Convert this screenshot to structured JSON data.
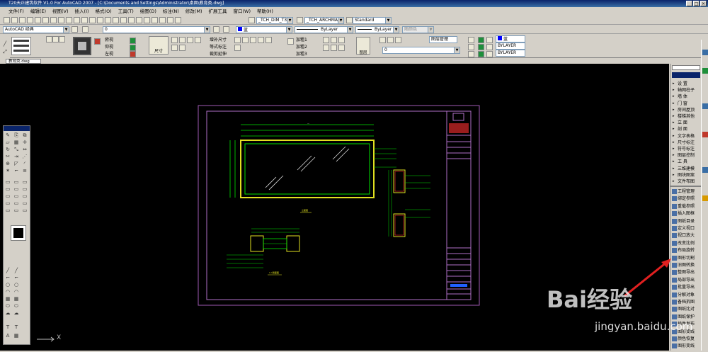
{
  "window": {
    "title": "T20天正建筑软件 V1.0 For AutoCAD 2007 - [C:\\Documents and Settings\\Administrator\\桌面\\教育类.dwg]",
    "controls": [
      "_",
      "□",
      "×"
    ]
  },
  "menu": [
    "文件(F)",
    "编辑(E)",
    "视图(V)",
    "插入(I)",
    "格式(O)",
    "工具(T)",
    "绘图(D)",
    "标注(N)",
    "修改(M)",
    "扩展工具",
    "窗口(W)",
    "帮助(H)"
  ],
  "toolbar2": {
    "dim_style": "_TCH_DIM_T3",
    "text_style": "_TCH_ARCHMAIN",
    "table_style": "Standard"
  },
  "toolbar3": {
    "workspace": "AutoCAD 经典",
    "layer": "0",
    "color": "蓝",
    "linetype": "ByLayer",
    "lineweight": "ByLayer",
    "plotstyle": "随颜色"
  },
  "ribbon": {
    "group1": [
      "俯视",
      "仰视",
      "左视"
    ],
    "group2_label": "尺寸",
    "group3": [
      "增补尺寸",
      "等式标注",
      "裁剪延伸"
    ],
    "group4": [
      "加粗1",
      "加粗2",
      "加粗3"
    ],
    "group5": [
      "图层管理",
      "图层"
    ],
    "layer_color": "蓝",
    "bylayer1": "BYLAYER",
    "bylayer2": "BYLAYER",
    "layer_zero": "0"
  },
  "doc_tab": "教育类.dwg",
  "right_panel": {
    "top_items": [
      "设 置",
      "轴网柱子",
      "墙 体",
      "门 窗",
      "房间屋顶",
      "楼梯其他",
      "立 面",
      "剖 面",
      "文字表格",
      "尺寸标注",
      "符号标注",
      "图层控制",
      "工 具",
      "三维建模",
      "图块图案",
      "文件布图"
    ],
    "bottom_items": [
      "工程管理",
      "绑定参照",
      "重载参照",
      "插入图框",
      "图纸目录",
      "定义视口",
      "视口放大",
      "改变比例",
      "布局旋转",
      "图形切割",
      "旧图转换",
      "整图导出",
      "局部导出",
      "批量导出",
      "分解对象",
      "备档拆图",
      "图纸比对",
      "图纸保护",
      "插件发布",
      "图形变线",
      "颜色恢复",
      "图形变线"
    ]
  },
  "drawing": {
    "section_label": "1-1剖面图",
    "elevation_label": "立面图"
  },
  "ucs_axis": "X",
  "watermark": {
    "brand": "Bai经验",
    "url": "jingyan.baidu.com"
  }
}
